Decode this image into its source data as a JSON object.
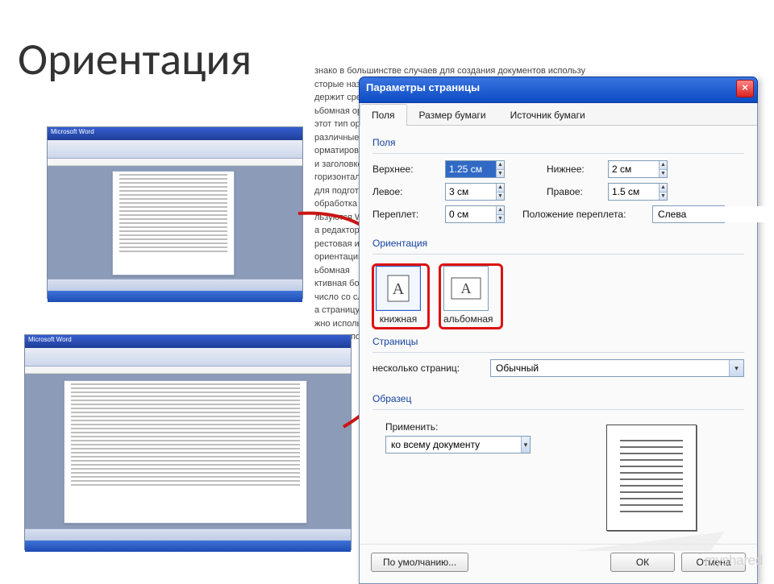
{
  "slide": {
    "title": "Ориентация"
  },
  "bg_lines": [
    "знако в большинстве случаев для создания документов использу",
    "сторые называют также текстовыми процессорами, имеет",
    "держит средства для работы с таблицами, графиками,",
    "ьбомная ориентация бумаги позволяет разместить ан",
    "этот тип ориентации чаще используется для печати ра",
    "различные параметры, редактировать текст, а также",
    "орматирование шрифта, абзаца, оформление и",
    "и заголовков; предопределяют подготовку; 2",
    "горизонтальную полосу прокрутки, пр",
    "для подготовки к изданию книг, журналов",
    "обработка текста — настольные издд",
    "",
    "льзуются Web-редакторы",
    "а редакторов, 5.2",
    "рестовая информация на компьютере используется в таких",
    "ориентации страницы",
    "",
    "ьбомная",
    "ктивная большие таблицы, которые повышают возможности",
    "число со сложной структурой",
    "а страницу производится ручная",
    "жно использовать составные документы, т.е. различные акр",
    "равно использовать любое другое"
  ],
  "dialog": {
    "title": "Параметры страницы",
    "close_icon": "×",
    "tabs": [
      "Поля",
      "Размер бумаги",
      "Источник бумаги"
    ],
    "active_tab": 0,
    "groups": {
      "fields": "Поля",
      "orientation": "Ориентация",
      "pages": "Страницы",
      "sample": "Образец"
    },
    "margins": {
      "top_label": "Верхнее:",
      "top_value": "1.25 см",
      "bottom_label": "Нижнее:",
      "bottom_value": "2 см",
      "left_label": "Левое:",
      "left_value": "3 см",
      "right_label": "Правое:",
      "right_value": "1.5 см",
      "gutter_label": "Переплет:",
      "gutter_value": "0 см",
      "gutter_pos_label": "Положение переплета:",
      "gutter_pos_value": "Слева"
    },
    "orientation": {
      "portrait": "книжная",
      "landscape": "альбомная"
    },
    "pages": {
      "multi_label": "несколько страниц:",
      "multi_value": "Обычный"
    },
    "apply": {
      "label": "Применить:",
      "value": "ко всему документу"
    },
    "buttons": {
      "default": "По умолчанию...",
      "ok": "ОК",
      "cancel": "Отмена"
    }
  },
  "thumb": {
    "app_title": "Microsoft Word"
  },
  "watermark": "myshared"
}
